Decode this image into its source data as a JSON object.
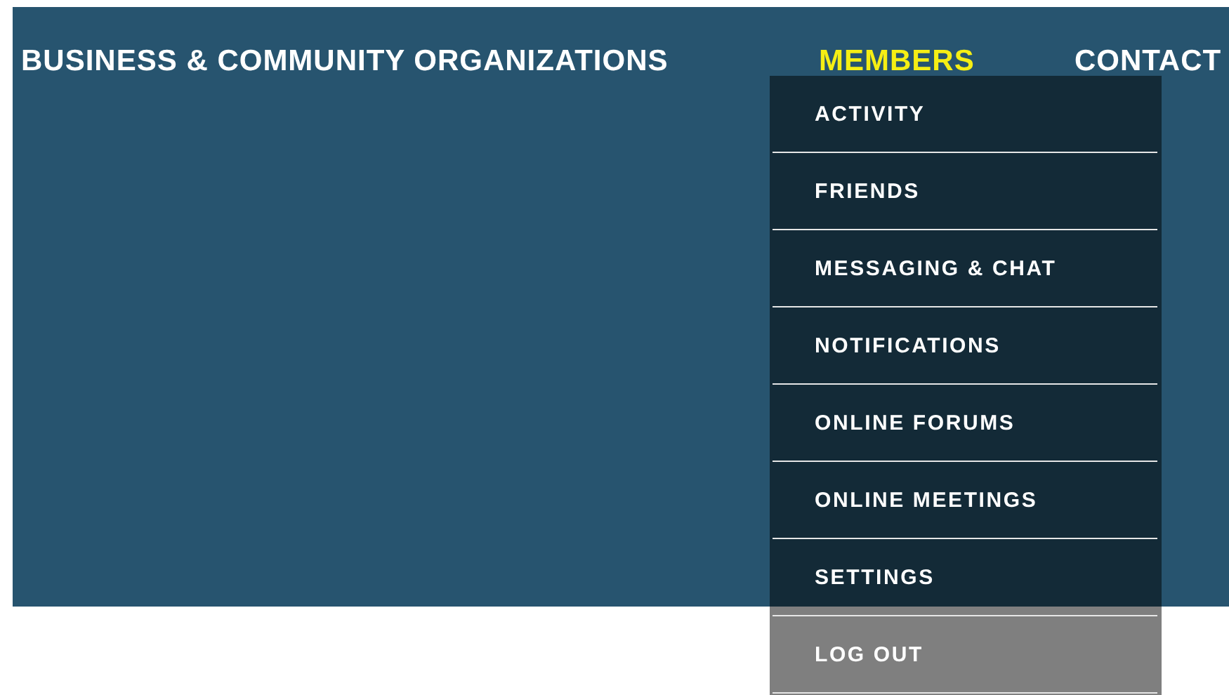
{
  "nav": [
    {
      "label": "BUSINESS & COMMUNITY ORGANIZATIONS",
      "selected": false
    },
    {
      "label": "MEMBERS",
      "selected": true
    },
    {
      "label": "CONTACT",
      "selected": false
    }
  ],
  "dropdown": {
    "items": [
      {
        "label": "ACTIVITY"
      },
      {
        "label": "FRIENDS"
      },
      {
        "label": "MESSAGING & CHAT"
      },
      {
        "label": "NOTIFICATIONS"
      },
      {
        "label": "ONLINE FORUMS"
      },
      {
        "label": "ONLINE MEETINGS"
      },
      {
        "label": "SETTINGS"
      },
      {
        "label": "LOG OUT"
      }
    ]
  }
}
